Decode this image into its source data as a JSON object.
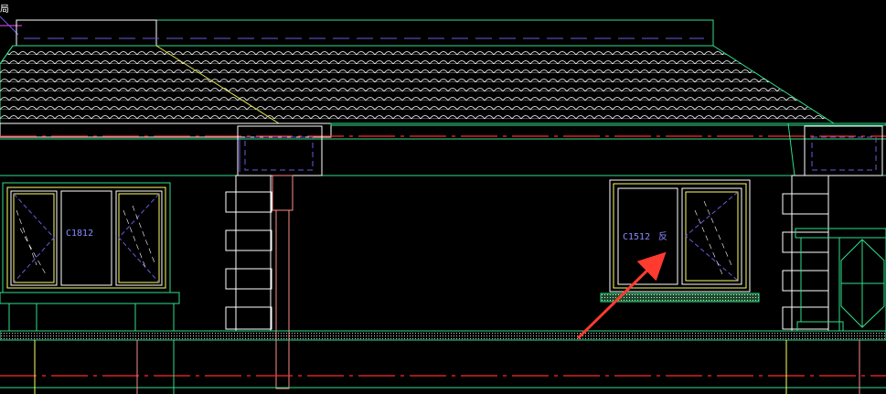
{
  "corner_label": "局",
  "labels": {
    "window_left": "C1812",
    "window_right": "C1512",
    "window_right_suffix": "反"
  },
  "colors": {
    "background": "#000000",
    "outline": "#2ee08a",
    "outline_white": "#ffffff",
    "window_frame": "#ffff66",
    "window_inner": "#ffffff",
    "dash_purple": "#6a5adf",
    "center_red": "#ff2a2a",
    "label_blue": "#8a8aff",
    "arrow_red": "#ff3b30",
    "pink_line": "#ff8a8a",
    "yellow_line": "#e6e650"
  }
}
